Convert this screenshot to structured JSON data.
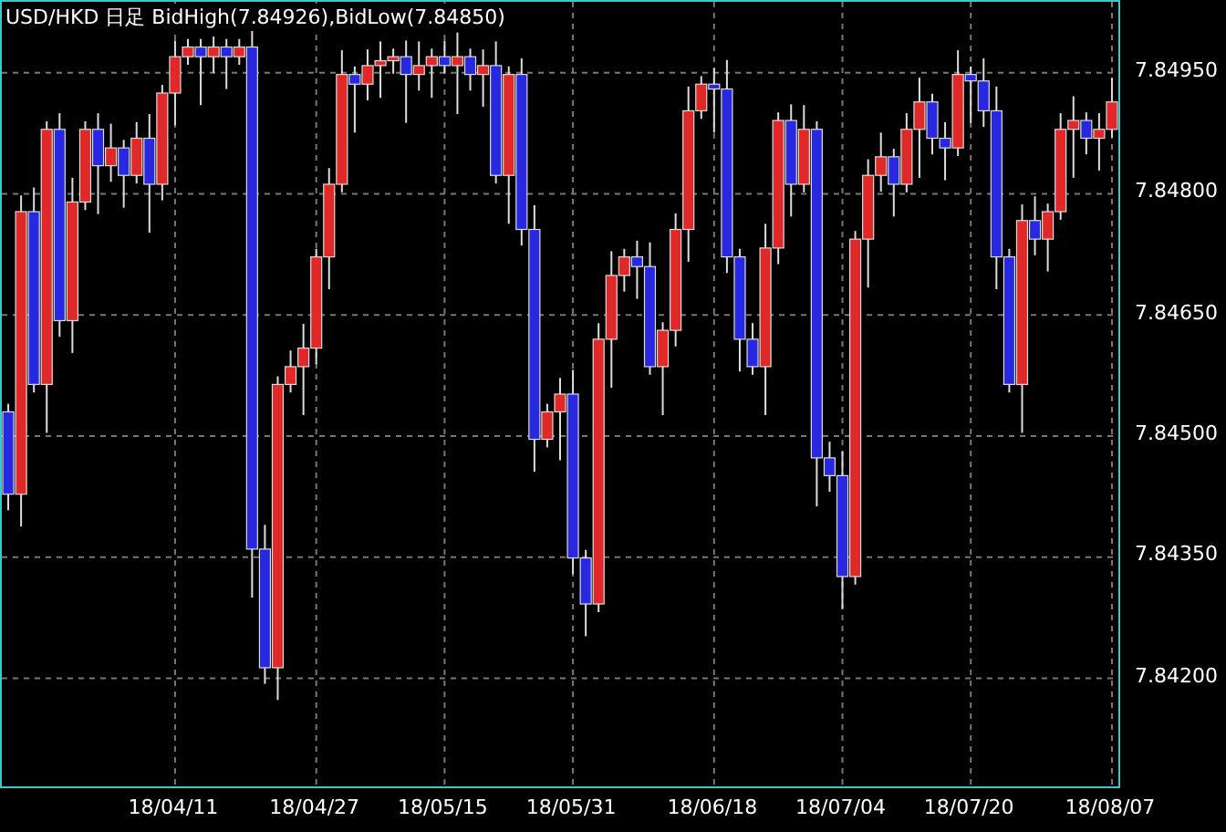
{
  "chart": {
    "title": "USD/HKD 日足 BidHigh(7.84926),BidLow(7.84850)",
    "chart_data": {
      "type": "candlestick",
      "ylim": [
        7.84066,
        7.85038
      ],
      "grid": true,
      "categories": [
        null,
        null,
        null,
        null,
        null,
        null,
        null,
        null,
        null,
        null,
        null,
        null,
        null,
        "18/04/11",
        null,
        null,
        null,
        null,
        null,
        null,
        null,
        null,
        null,
        null,
        "18/04/27",
        null,
        null,
        null,
        null,
        null,
        null,
        null,
        null,
        null,
        "18/05/15",
        null,
        null,
        null,
        null,
        null,
        null,
        null,
        null,
        null,
        "18/05/31",
        null,
        null,
        null,
        null,
        null,
        null,
        null,
        null,
        null,
        null,
        "18/06/18",
        null,
        null,
        null,
        null,
        null,
        null,
        null,
        null,
        null,
        "18/07/04",
        null,
        null,
        null,
        null,
        null,
        null,
        null,
        null,
        null,
        "18/07/20",
        null,
        null,
        null,
        null,
        null,
        null,
        null,
        null,
        null,
        null,
        "18/08/07"
      ],
      "yticks": [
        {
          "value": 7.8495,
          "label": "7.84950"
        },
        {
          "value": 7.848,
          "label": "7.84800"
        },
        {
          "value": 7.8465,
          "label": "7.84650"
        },
        {
          "value": 7.845,
          "label": "7.84500"
        },
        {
          "value": 7.8435,
          "label": "7.84350"
        },
        {
          "value": 7.842,
          "label": "7.84200"
        }
      ],
      "ohlc": [
        [
          7.8453,
          7.8454,
          7.84408,
          7.84428
        ],
        [
          7.84428,
          7.84798,
          7.84388,
          7.84778
        ],
        [
          7.84778,
          7.84808,
          7.84554,
          7.84564
        ],
        [
          7.84564,
          7.8489,
          7.84504,
          7.8488
        ],
        [
          7.8488,
          7.849,
          7.84623,
          7.84643
        ],
        [
          7.84643,
          7.8482,
          7.84603,
          7.8479
        ],
        [
          7.8479,
          7.8489,
          7.8478,
          7.8488
        ],
        [
          7.8488,
          7.849,
          7.84775,
          7.84835
        ],
        [
          7.84835,
          7.84887,
          7.84815,
          7.84857
        ],
        [
          7.84857,
          7.84867,
          7.84783,
          7.84823
        ],
        [
          7.84823,
          7.84889,
          7.84813,
          7.84869
        ],
        [
          7.84869,
          7.84899,
          7.84752,
          7.84812
        ],
        [
          7.84812,
          7.84935,
          7.84792,
          7.84925
        ],
        [
          7.84925,
          7.8499,
          7.84885,
          7.8497
        ],
        [
          7.8497,
          7.84992,
          7.8496,
          7.84982
        ],
        [
          7.84982,
          7.84992,
          7.8491,
          7.8497
        ],
        [
          7.8497,
          7.84995,
          7.8495,
          7.84982
        ],
        [
          7.84982,
          7.84992,
          7.8493,
          7.8497
        ],
        [
          7.8497,
          7.84992,
          7.8496,
          7.84982
        ],
        [
          7.84982,
          7.85002,
          7.843,
          7.8436
        ],
        [
          7.8436,
          7.8439,
          7.84193,
          7.84213
        ],
        [
          7.84213,
          7.84574,
          7.84173,
          7.84564
        ],
        [
          7.84564,
          7.84606,
          7.84554,
          7.84586
        ],
        [
          7.84586,
          7.84639,
          7.84526,
          7.84609
        ],
        [
          7.84609,
          7.84732,
          7.84589,
          7.84722
        ],
        [
          7.84722,
          7.84832,
          7.84682,
          7.84812
        ],
        [
          7.84812,
          7.84978,
          7.84802,
          7.84948
        ],
        [
          7.84948,
          7.84958,
          7.84876,
          7.84936
        ],
        [
          7.84936,
          7.84979,
          7.84916,
          7.84959
        ],
        [
          7.84959,
          7.84989,
          7.84919,
          7.84965
        ],
        [
          7.84965,
          7.8498,
          7.84949,
          7.8497
        ],
        [
          7.8497,
          7.8499,
          7.84888,
          7.84948
        ],
        [
          7.84948,
          7.84989,
          7.84928,
          7.84959
        ],
        [
          7.84959,
          7.8498,
          7.84919,
          7.8497
        ],
        [
          7.8497,
          7.8499,
          7.84949,
          7.84959
        ],
        [
          7.84959,
          7.85,
          7.84899,
          7.8497
        ],
        [
          7.8497,
          7.8498,
          7.84928,
          7.84948
        ],
        [
          7.84948,
          7.84979,
          7.84908,
          7.84959
        ],
        [
          7.84959,
          7.84989,
          7.84813,
          7.84823
        ],
        [
          7.84823,
          7.84958,
          7.84763,
          7.84948
        ],
        [
          7.84948,
          7.84968,
          7.84736,
          7.84756
        ],
        [
          7.84756,
          7.84786,
          7.84456,
          7.84496
        ],
        [
          7.84496,
          7.8454,
          7.84486,
          7.8453
        ],
        [
          7.8453,
          7.84572,
          7.8447,
          7.84552
        ],
        [
          7.84552,
          7.84582,
          7.84329,
          7.84349
        ],
        [
          7.84349,
          7.84359,
          7.84252,
          7.84292
        ],
        [
          7.84292,
          7.8464,
          7.84282,
          7.8462
        ],
        [
          7.8462,
          7.84729,
          7.8456,
          7.84699
        ],
        [
          7.84699,
          7.84732,
          7.84679,
          7.84722
        ],
        [
          7.84722,
          7.84742,
          7.8467,
          7.8471
        ],
        [
          7.8471,
          7.8474,
          7.84576,
          7.84586
        ],
        [
          7.84586,
          7.84641,
          7.84526,
          7.84631
        ],
        [
          7.84631,
          7.84776,
          7.84611,
          7.84756
        ],
        [
          7.84756,
          7.84933,
          7.84716,
          7.84903
        ],
        [
          7.84903,
          7.84946,
          7.84893,
          7.84936
        ],
        [
          7.84936,
          7.84956,
          7.84876,
          7.8493
        ],
        [
          7.8493,
          7.84966,
          7.84702,
          7.84722
        ],
        [
          7.84722,
          7.84732,
          7.8458,
          7.8462
        ],
        [
          7.8462,
          7.8464,
          7.84576,
          7.84586
        ],
        [
          7.84586,
          7.84763,
          7.84526,
          7.84733
        ],
        [
          7.84733,
          7.84901,
          7.84713,
          7.84891
        ],
        [
          7.84891,
          7.84911,
          7.84772,
          7.84812
        ],
        [
          7.84812,
          7.8491,
          7.84802,
          7.8488
        ],
        [
          7.8488,
          7.8489,
          7.84413,
          7.84473
        ],
        [
          7.84473,
          7.84493,
          7.84431,
          7.84451
        ],
        [
          7.84451,
          7.84481,
          7.84286,
          7.84326
        ],
        [
          7.84326,
          7.84754,
          7.84316,
          7.84744
        ],
        [
          7.84744,
          7.84843,
          7.84684,
          7.84823
        ],
        [
          7.84823,
          7.84876,
          7.84803,
          7.84846
        ],
        [
          7.84846,
          7.84856,
          7.84772,
          7.84812
        ],
        [
          7.84812,
          7.849,
          7.84802,
          7.8488
        ],
        [
          7.8488,
          7.84944,
          7.8482,
          7.84914
        ],
        [
          7.84914,
          7.84924,
          7.84849,
          7.84869
        ],
        [
          7.84869,
          7.84889,
          7.84817,
          7.84857
        ],
        [
          7.84857,
          7.84978,
          7.84847,
          7.84948
        ],
        [
          7.84948,
          7.84958,
          7.84888,
          7.8494
        ],
        [
          7.8494,
          7.84968,
          7.84883,
          7.84903
        ],
        [
          7.84903,
          7.84933,
          7.84682,
          7.84722
        ],
        [
          7.84722,
          7.84732,
          7.84554,
          7.84564
        ],
        [
          7.84564,
          7.84787,
          7.84504,
          7.84767
        ],
        [
          7.84767,
          7.84797,
          7.84724,
          7.84744
        ],
        [
          7.84744,
          7.84788,
          7.84704,
          7.84778
        ],
        [
          7.84778,
          7.849,
          7.84768,
          7.8488
        ],
        [
          7.8488,
          7.84921,
          7.8482,
          7.84891
        ],
        [
          7.84891,
          7.84901,
          7.84849,
          7.84869
        ],
        [
          7.84869,
          7.849,
          7.84829,
          7.8488
        ],
        [
          7.8488,
          7.84944,
          7.8487,
          7.84914
        ]
      ]
    }
  }
}
